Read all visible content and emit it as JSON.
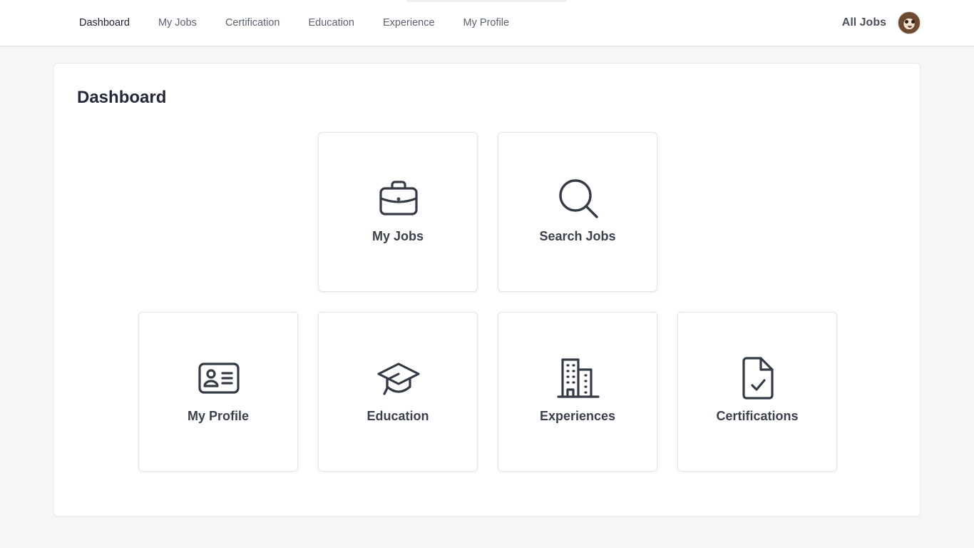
{
  "nav": {
    "items": [
      {
        "label": "Dashboard",
        "active": true
      },
      {
        "label": "My Jobs",
        "active": false
      },
      {
        "label": "Certification",
        "active": false
      },
      {
        "label": "Education",
        "active": false
      },
      {
        "label": "Experience",
        "active": false
      },
      {
        "label": "My Profile",
        "active": false
      }
    ],
    "all_jobs_label": "All Jobs"
  },
  "page": {
    "title": "Dashboard"
  },
  "tiles": [
    {
      "label": "My Jobs",
      "icon": "briefcase-icon"
    },
    {
      "label": "Search Jobs",
      "icon": "search-icon"
    },
    {
      "label": "My Profile",
      "icon": "id-card-icon"
    },
    {
      "label": "Education",
      "icon": "graduation-cap-icon"
    },
    {
      "label": "Experiences",
      "icon": "building-icon"
    },
    {
      "label": "Certifications",
      "icon": "certificate-file-icon"
    }
  ],
  "colors": {
    "background": "#f6f6f6",
    "card": "#ffffff",
    "icon_stroke": "#343a46",
    "text_dark": "#22283a"
  }
}
